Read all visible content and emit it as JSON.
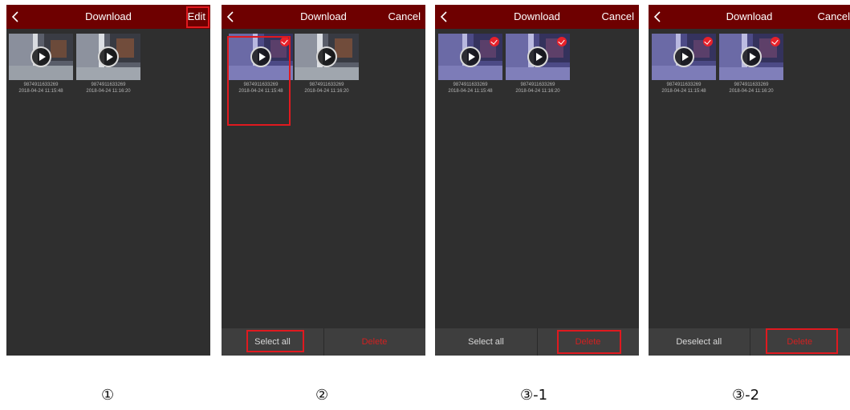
{
  "screens": [
    {
      "title": "Download",
      "action": "Edit",
      "thumbs": [
        {
          "id": "9874911633269",
          "time": "2018-04-24 11:15:48"
        },
        {
          "id": "9874911633269",
          "time": "2018-04-24 11:16:20"
        }
      ]
    },
    {
      "title": "Download",
      "action": "Cancel",
      "thumbs": [
        {
          "id": "9874911633269",
          "time": "2018-04-24 11:15:48",
          "selected": true
        },
        {
          "id": "9874911633269",
          "time": "2018-04-24 11:16:20",
          "selected": false
        }
      ],
      "bottom": {
        "left": "Select all",
        "right": "Delete"
      }
    },
    {
      "title": "Download",
      "action": "Cancel",
      "thumbs": [
        {
          "id": "9874911633269",
          "time": "2018-04-24 11:15:48",
          "selected": true
        },
        {
          "id": "9874911633269",
          "time": "2018-04-24 11:16:20",
          "selected": true
        }
      ],
      "bottom": {
        "left": "Select all",
        "right": "Delete"
      }
    },
    {
      "title": "Download",
      "action": "Cancel",
      "thumbs": [
        {
          "id": "9874911633269",
          "time": "2018-04-24 11:15:48",
          "selected": true
        },
        {
          "id": "9874911633269",
          "time": "2018-04-24 11:16:20",
          "selected": true
        }
      ],
      "bottom": {
        "left": "Deselect all",
        "right": "Delete"
      }
    }
  ],
  "step_labels": [
    "①",
    "②",
    "③-1",
    "③-2"
  ],
  "colors": {
    "header": "#6e0000",
    "screen_bg": "#2f2f2f",
    "highlight": "#e0191f",
    "delete_text": "#d32020"
  },
  "icons": {
    "back": "chevron-left-icon",
    "play": "play-icon",
    "check": "check-circle-icon"
  }
}
